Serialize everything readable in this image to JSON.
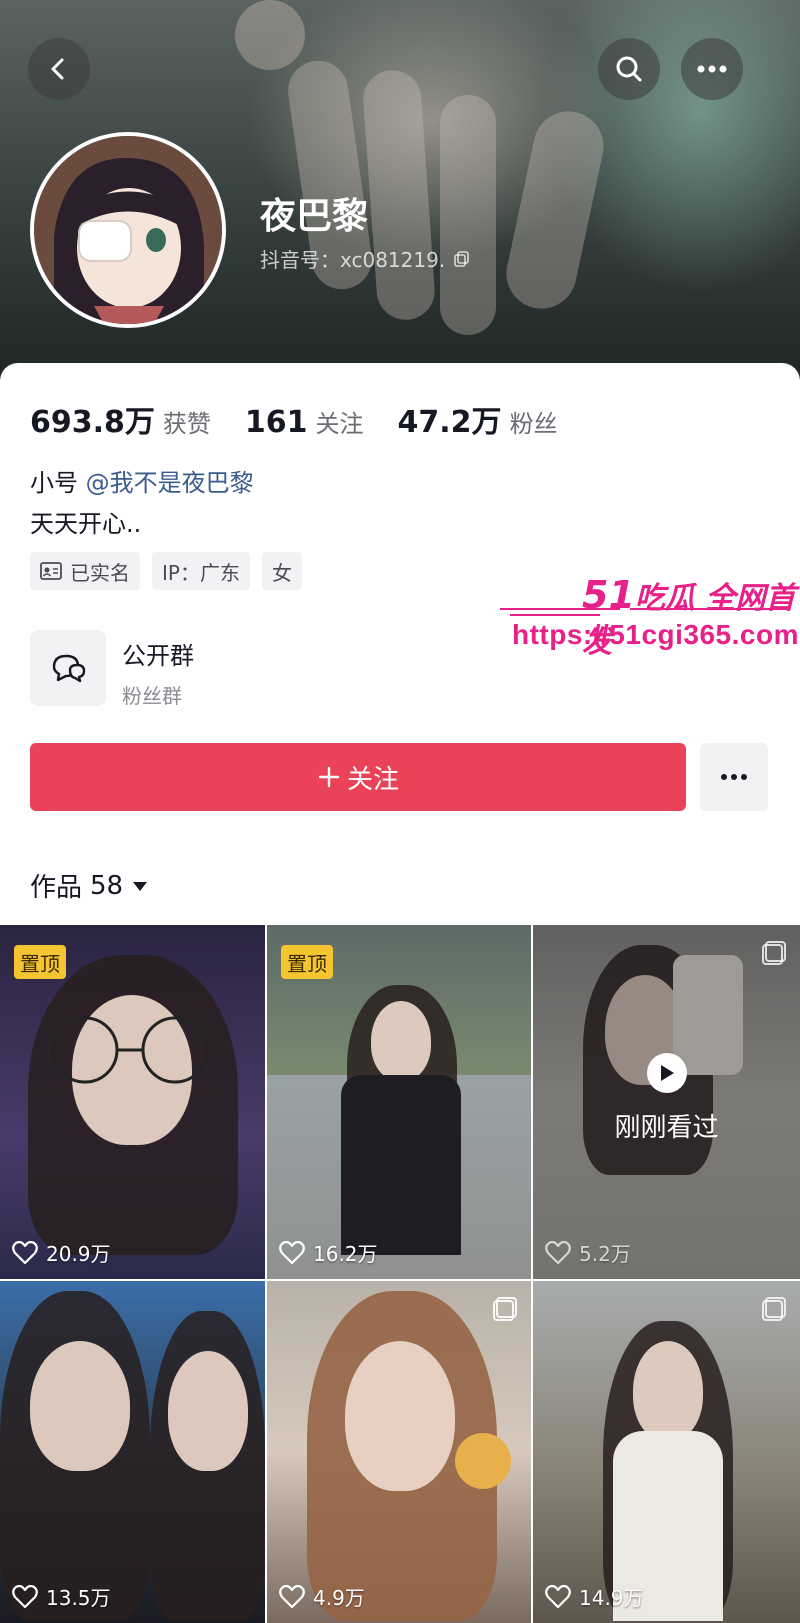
{
  "header": {
    "name": "夜巴黎",
    "douyin_id": "抖音号：xc081219."
  },
  "stats": [
    {
      "num": "693.8万",
      "label": "获赞"
    },
    {
      "num": "161",
      "label": "关注"
    },
    {
      "num": "47.2万",
      "label": "粉丝"
    }
  ],
  "bio": {
    "prefix": "小号",
    "mention": "@我不是夜巴黎",
    "line2": "天天开心.."
  },
  "tags": [
    "已实名",
    "IP：广东",
    "女"
  ],
  "group": {
    "title": "公开群",
    "subtitle": "粉丝群"
  },
  "follow_button": "关注",
  "works": {
    "label": "作品",
    "count": "58"
  },
  "watermark": {
    "line1_num": "51",
    "line1_text": "吃瓜 全网首发",
    "url": "https://51cgi365.com"
  },
  "videos": [
    {
      "likes": "20.9万",
      "badge": "置顶"
    },
    {
      "likes": "16.2万",
      "badge": "置顶"
    },
    {
      "likes": "5.2万",
      "overlay": "刚刚看过"
    },
    {
      "likes": "13.5万"
    },
    {
      "likes": "4.9万"
    },
    {
      "likes": "14.9万"
    }
  ],
  "colors": {
    "follow": "#ea4357",
    "pin_badge": "#f4c431",
    "mention": "#3b5b8e",
    "watermark": "#e8208a"
  }
}
